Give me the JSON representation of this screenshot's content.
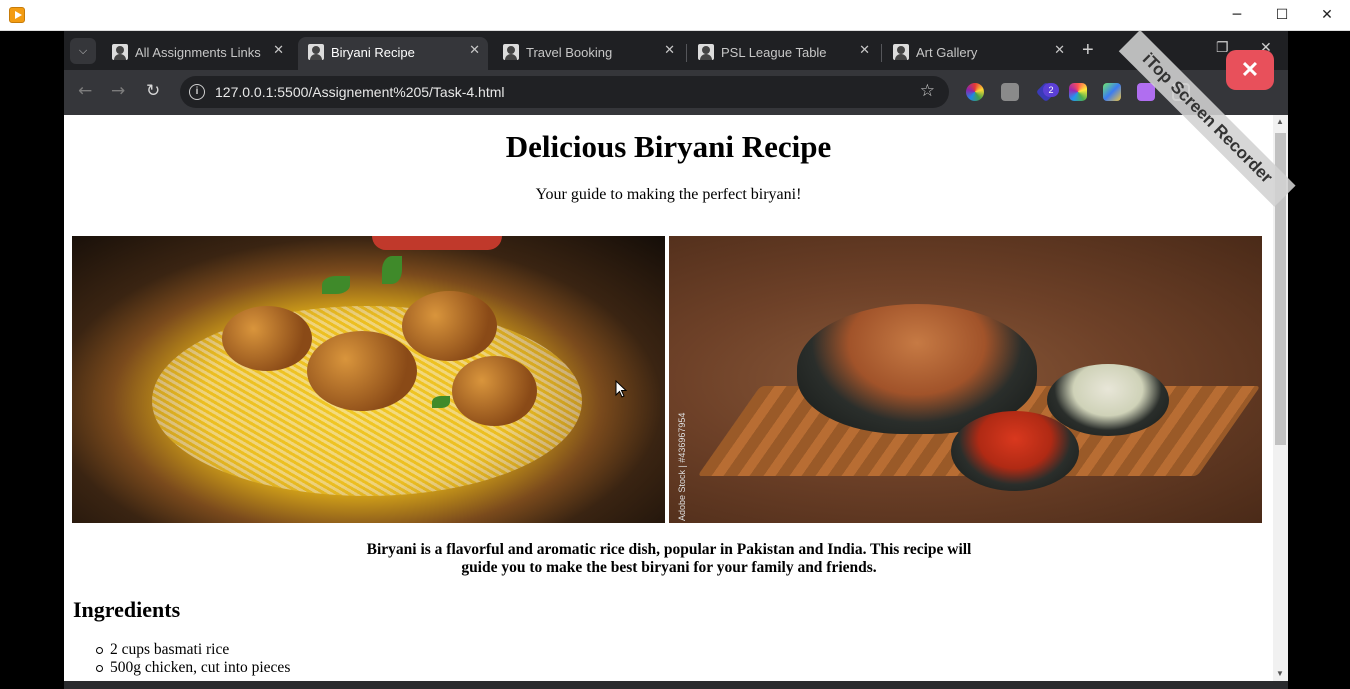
{
  "window": {
    "minimize": "─",
    "maximize": "☐",
    "close": "✕"
  },
  "browser": {
    "tabs": [
      {
        "label": "All Assignments Links",
        "active": false
      },
      {
        "label": "Biryani Recipe",
        "active": true
      },
      {
        "label": "Travel Booking",
        "active": false
      },
      {
        "label": "PSL League Table",
        "active": false
      },
      {
        "label": "Art Gallery",
        "active": false
      }
    ],
    "new_tab": "+",
    "url": "127.0.0.1:5500/Assignement%205/Task-4.html",
    "extension_badge": "2",
    "icons": [
      "back-icon",
      "forward-icon",
      "reload-icon",
      "info-icon",
      "bookmark-star-icon",
      "extensions-icon",
      "tab-search-icon"
    ]
  },
  "watermark": {
    "text": "iTop Screen Recorder"
  },
  "page": {
    "title": "Delicious Biryani Recipe",
    "subtitle": "Your guide to making the perfect biryani!",
    "image_caption": "Adobe Stock | #436967954",
    "intro": "Biryani is a flavorful and aromatic rice dish, popular in Pakistan and India. This recipe will guide you to make the best biryani for your family and friends.",
    "ingredients_heading": "Ingredients",
    "ingredients": [
      "2 cups basmati rice",
      "500g chicken, cut into pieces"
    ]
  },
  "colors": {
    "tab_bar": "#1f2023",
    "toolbar": "#35363a",
    "omnibox": "#202124",
    "page_bg": "#ffffff"
  }
}
